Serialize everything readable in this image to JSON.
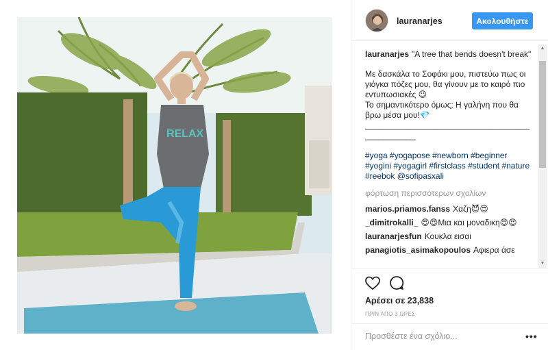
{
  "post": {
    "image_alt": "",
    "username": "lauranarjes",
    "follow_label": "Ακολουθήστε"
  },
  "caption": {
    "username": "lauranarjes",
    "title": "\"A tree that bends doesn't break\"",
    "line1": "Με δασκάλα το Σοφάκι μου, πιστεύω πως οι γιόγκα πόζες μου, θα γίνουν με το καιρό πιο εντυπωσιακές 😉",
    "line2": "Το σημαντικότερο όμως; Η γαλήνη που θα βρω μέσα μου!💎",
    "separator": "_______________________________________________",
    "hashtags": "#yoga #yogapose #newborn #beginner #yogini #yogagirl #firstclass #student #nature #reebok @sofipasxali"
  },
  "load_more": "φόρτωση περισσότερων σχολίων",
  "comments": [
    {
      "user": "marios.priamos.fanss",
      "text": "Χαζη😈😍"
    },
    {
      "user": "_dimitrokalli_",
      "text": "😍😍Μια και μοναδικη😍😍"
    },
    {
      "user": "lauranarjesfun",
      "text": "Κουκλα εισαι"
    },
    {
      "user": "panagiotis_asimakopoulos",
      "text": "Αφιερα άσε"
    }
  ],
  "actions": {
    "like_icon": "heart-icon",
    "comment_icon": "speech-bubble-icon",
    "likes_text": "Αρέσει σε 23,838",
    "time_text": "ΠΡΙΝ ΑΠΟ 3 ΩΡΕΣ"
  },
  "add_comment": {
    "placeholder": "Προσθέστε ένα σχόλιο...",
    "more_label": "•••"
  },
  "colors": {
    "accent": "#3897f0",
    "hashtag": "#003569",
    "text": "#262626",
    "muted": "#999999"
  }
}
